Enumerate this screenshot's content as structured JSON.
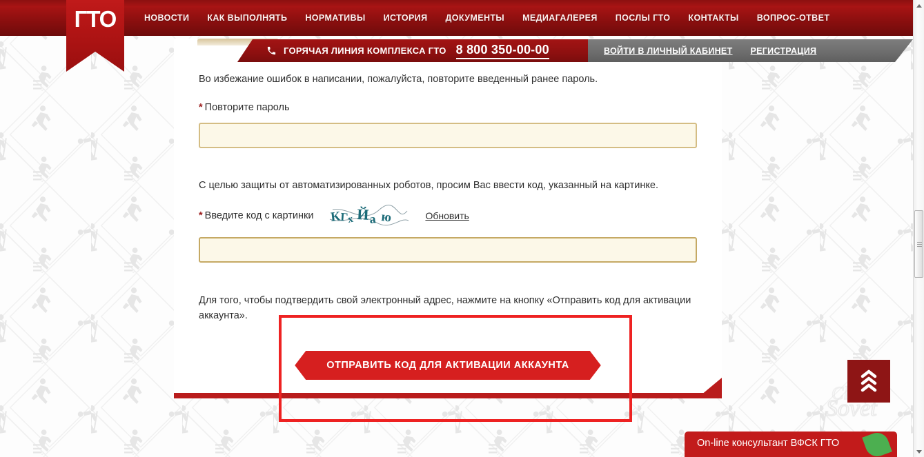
{
  "site": {
    "logo_text": "ГТО"
  },
  "nav": {
    "items": [
      {
        "label": "НОВОСТИ",
        "name": "nav-news"
      },
      {
        "label": "КАК ВЫПОЛНЯТЬ",
        "name": "nav-how-to"
      },
      {
        "label": "НОРМАТИВЫ",
        "name": "nav-standards"
      },
      {
        "label": "ИСТОРИЯ",
        "name": "nav-history"
      },
      {
        "label": "ДОКУМЕНТЫ",
        "name": "nav-documents"
      },
      {
        "label": "МЕДИАГАЛЕРЕЯ",
        "name": "nav-media-gallery"
      },
      {
        "label": "ПОСЛЫ ГТО",
        "name": "nav-ambassadors"
      },
      {
        "label": "КОНТАКТЫ",
        "name": "nav-contacts"
      },
      {
        "label": "ВОПРОС-ОТВЕТ",
        "name": "nav-faq"
      }
    ]
  },
  "hotline": {
    "label": "ГОРЯЧАЯ ЛИНИЯ КОМПЛЕКСА ГТО",
    "number": "8 800 350-00-00",
    "login_link": "ВОЙТИ В ЛИЧНЫЙ КАБИНЕТ",
    "register_link": "РЕГИСТРАЦИЯ"
  },
  "form": {
    "password_hint": "Во избежание ошибок в написании, пожалуйста, повторите введенный ранее пароль.",
    "password_label": "Повторите пароль",
    "password_value": "",
    "password_placeholder": "",
    "required_marker": "*",
    "captcha_hint": "С целью защиты от автоматизированных роботов, просим Вас ввести код, указанный на картинке.",
    "captcha_label": "Введите код с картинки",
    "captcha_text": "КГхЙаю",
    "captcha_refresh": "Обновить",
    "captcha_value": "",
    "captcha_placeholder": "",
    "submit_hint": "Для того, чтобы подтвердить свой электронный адрес, нажмите на кнопку «Отправить код для активации аккаунта».",
    "submit_label": "ОТПРАВИТЬ КОД ДЛЯ АКТИВАЦИИ АККАУНТА"
  },
  "widgets": {
    "consultant_label": "On-line консультант ВФСК ГТО",
    "scroll_top_name": "scroll-to-top-button",
    "watermark_text": "SovetClub"
  },
  "colors": {
    "brand_red": "#a81414",
    "button_red": "#d61f1f",
    "annotation_red": "#ee2222",
    "input_bg": "#fcf8e8",
    "input_border": "#d4bd84",
    "gray_bar": "#6e6e6e",
    "consultant_red": "#c21b1b",
    "leaf_green": "#4caf50"
  }
}
